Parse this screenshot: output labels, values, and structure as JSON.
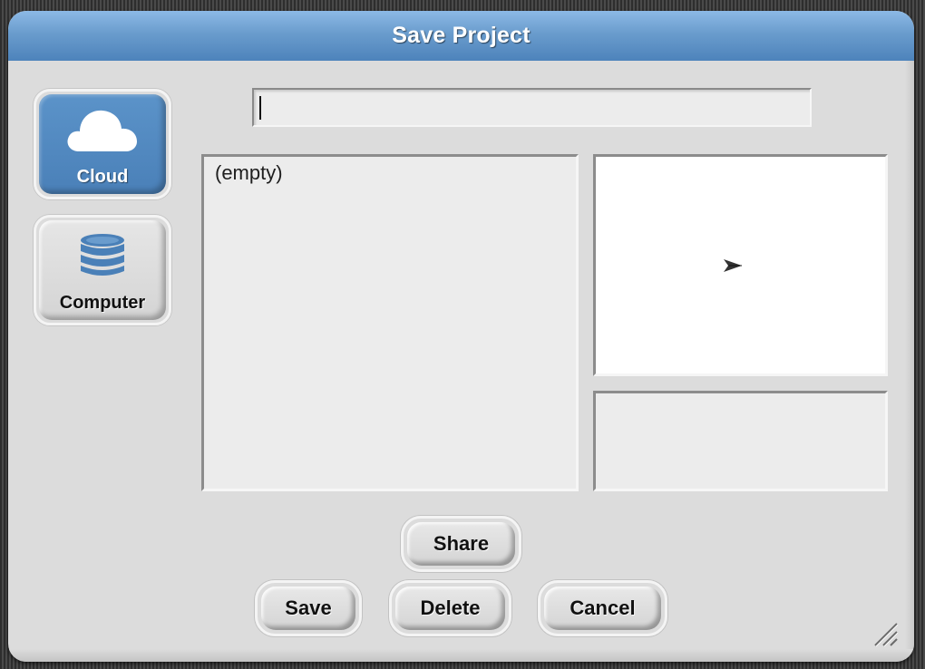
{
  "dialog": {
    "title": "Save Project"
  },
  "sources": {
    "cloud": {
      "label": "Cloud",
      "icon": "cloud-icon",
      "selected": true
    },
    "computer": {
      "label": "Computer",
      "icon": "database-icon",
      "selected": false
    }
  },
  "name_field": {
    "value": "",
    "placeholder": ""
  },
  "project_list": {
    "items": [
      "(empty)"
    ]
  },
  "preview": {
    "icon": "sprite-arrow-icon"
  },
  "buttons": {
    "share": "Share",
    "save": "Save",
    "delete": "Delete",
    "cancel": "Cancel"
  },
  "colors": {
    "accent": "#4a80b8",
    "titlebar": "#6a9ccd",
    "dialog_bg": "#dcdcdc"
  }
}
